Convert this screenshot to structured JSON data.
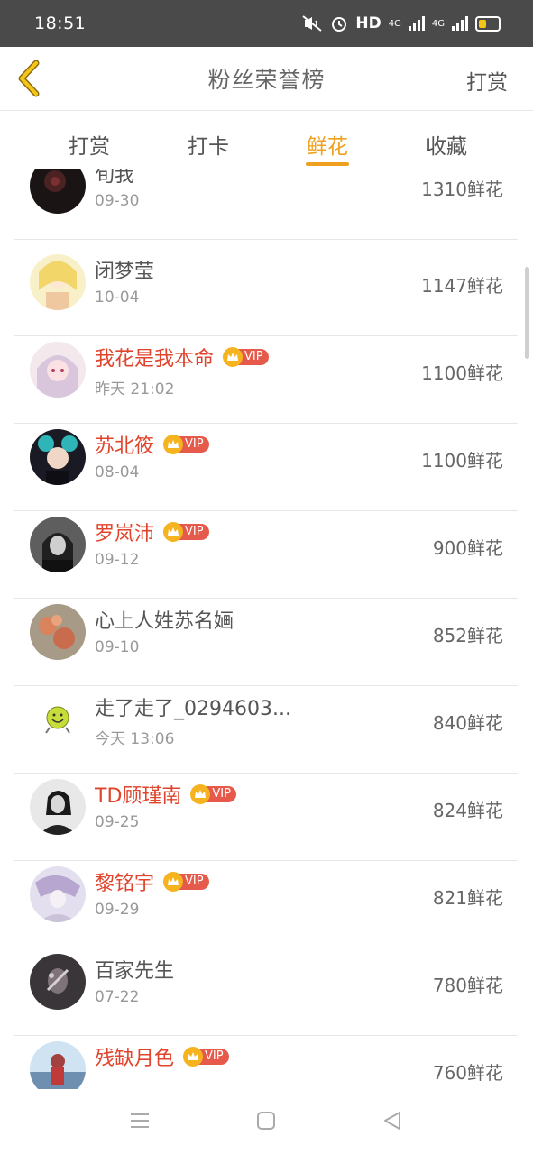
{
  "status_bar": {
    "time": "18:51",
    "hd_label": "HD",
    "network_label_1": "4G",
    "network_label_2": "4G"
  },
  "header": {
    "title": "粉丝荣誉榜",
    "right_action": "打赏"
  },
  "tabs": [
    {
      "label": "打赏",
      "active": false
    },
    {
      "label": "打卡",
      "active": false
    },
    {
      "label": "鲜花",
      "active": true
    },
    {
      "label": "收藏",
      "active": false
    }
  ],
  "vip_label": "VIP",
  "list": [
    {
      "name": "旬我",
      "date": "09-30",
      "amount": "1310鲜花",
      "vip": false
    },
    {
      "name": "闭梦莹",
      "date": "10-04",
      "amount": "1147鲜花",
      "vip": false
    },
    {
      "name": "我花是我本命",
      "date": "昨天 21:02",
      "amount": "1100鲜花",
      "vip": true
    },
    {
      "name": "苏北筱",
      "date": "08-04",
      "amount": "1100鲜花",
      "vip": true
    },
    {
      "name": "罗岚沛",
      "date": "09-12",
      "amount": "900鲜花",
      "vip": true
    },
    {
      "name": "心上人姓苏名婳",
      "date": "09-10",
      "amount": "852鲜花",
      "vip": false
    },
    {
      "name": "走了走了_0294603...",
      "date": "今天 13:06",
      "amount": "840鲜花",
      "vip": false
    },
    {
      "name": "TD顾瑾南",
      "date": "09-25",
      "amount": "824鲜花",
      "vip": true
    },
    {
      "name": "黎铭宇",
      "date": "09-29",
      "amount": "821鲜花",
      "vip": true
    },
    {
      "name": "百家先生",
      "date": "07-22",
      "amount": "780鲜花",
      "vip": false
    },
    {
      "name": "残缺月色",
      "date": "",
      "amount": "760鲜花",
      "vip": true
    }
  ],
  "colors": {
    "accent": "#f0a020",
    "vip_name": "#e0442c",
    "vip_badge": "#e55a4a",
    "crown": "#f5b320",
    "status_bar": "#4a4a4a"
  }
}
